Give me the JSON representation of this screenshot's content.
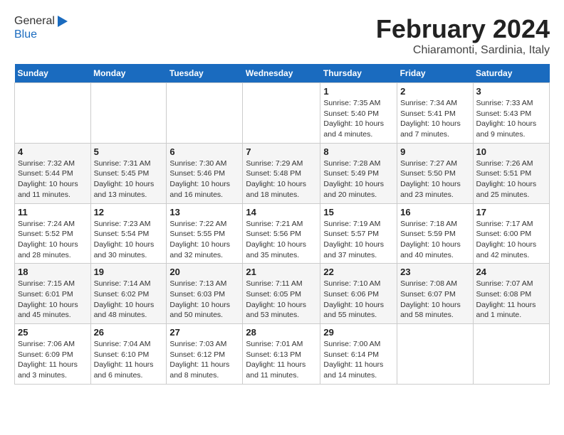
{
  "header": {
    "logo_general": "General",
    "logo_blue": "Blue",
    "title": "February 2024",
    "subtitle": "Chiaramonti, Sardinia, Italy"
  },
  "days_of_week": [
    "Sunday",
    "Monday",
    "Tuesday",
    "Wednesday",
    "Thursday",
    "Friday",
    "Saturday"
  ],
  "weeks": [
    [
      {
        "day": "",
        "info": ""
      },
      {
        "day": "",
        "info": ""
      },
      {
        "day": "",
        "info": ""
      },
      {
        "day": "",
        "info": ""
      },
      {
        "day": "1",
        "info": "Sunrise: 7:35 AM\nSunset: 5:40 PM\nDaylight: 10 hours\nand 4 minutes."
      },
      {
        "day": "2",
        "info": "Sunrise: 7:34 AM\nSunset: 5:41 PM\nDaylight: 10 hours\nand 7 minutes."
      },
      {
        "day": "3",
        "info": "Sunrise: 7:33 AM\nSunset: 5:43 PM\nDaylight: 10 hours\nand 9 minutes."
      }
    ],
    [
      {
        "day": "4",
        "info": "Sunrise: 7:32 AM\nSunset: 5:44 PM\nDaylight: 10 hours\nand 11 minutes."
      },
      {
        "day": "5",
        "info": "Sunrise: 7:31 AM\nSunset: 5:45 PM\nDaylight: 10 hours\nand 13 minutes."
      },
      {
        "day": "6",
        "info": "Sunrise: 7:30 AM\nSunset: 5:46 PM\nDaylight: 10 hours\nand 16 minutes."
      },
      {
        "day": "7",
        "info": "Sunrise: 7:29 AM\nSunset: 5:48 PM\nDaylight: 10 hours\nand 18 minutes."
      },
      {
        "day": "8",
        "info": "Sunrise: 7:28 AM\nSunset: 5:49 PM\nDaylight: 10 hours\nand 20 minutes."
      },
      {
        "day": "9",
        "info": "Sunrise: 7:27 AM\nSunset: 5:50 PM\nDaylight: 10 hours\nand 23 minutes."
      },
      {
        "day": "10",
        "info": "Sunrise: 7:26 AM\nSunset: 5:51 PM\nDaylight: 10 hours\nand 25 minutes."
      }
    ],
    [
      {
        "day": "11",
        "info": "Sunrise: 7:24 AM\nSunset: 5:52 PM\nDaylight: 10 hours\nand 28 minutes."
      },
      {
        "day": "12",
        "info": "Sunrise: 7:23 AM\nSunset: 5:54 PM\nDaylight: 10 hours\nand 30 minutes."
      },
      {
        "day": "13",
        "info": "Sunrise: 7:22 AM\nSunset: 5:55 PM\nDaylight: 10 hours\nand 32 minutes."
      },
      {
        "day": "14",
        "info": "Sunrise: 7:21 AM\nSunset: 5:56 PM\nDaylight: 10 hours\nand 35 minutes."
      },
      {
        "day": "15",
        "info": "Sunrise: 7:19 AM\nSunset: 5:57 PM\nDaylight: 10 hours\nand 37 minutes."
      },
      {
        "day": "16",
        "info": "Sunrise: 7:18 AM\nSunset: 5:59 PM\nDaylight: 10 hours\nand 40 minutes."
      },
      {
        "day": "17",
        "info": "Sunrise: 7:17 AM\nSunset: 6:00 PM\nDaylight: 10 hours\nand 42 minutes."
      }
    ],
    [
      {
        "day": "18",
        "info": "Sunrise: 7:15 AM\nSunset: 6:01 PM\nDaylight: 10 hours\nand 45 minutes."
      },
      {
        "day": "19",
        "info": "Sunrise: 7:14 AM\nSunset: 6:02 PM\nDaylight: 10 hours\nand 48 minutes."
      },
      {
        "day": "20",
        "info": "Sunrise: 7:13 AM\nSunset: 6:03 PM\nDaylight: 10 hours\nand 50 minutes."
      },
      {
        "day": "21",
        "info": "Sunrise: 7:11 AM\nSunset: 6:05 PM\nDaylight: 10 hours\nand 53 minutes."
      },
      {
        "day": "22",
        "info": "Sunrise: 7:10 AM\nSunset: 6:06 PM\nDaylight: 10 hours\nand 55 minutes."
      },
      {
        "day": "23",
        "info": "Sunrise: 7:08 AM\nSunset: 6:07 PM\nDaylight: 10 hours\nand 58 minutes."
      },
      {
        "day": "24",
        "info": "Sunrise: 7:07 AM\nSunset: 6:08 PM\nDaylight: 11 hours\nand 1 minute."
      }
    ],
    [
      {
        "day": "25",
        "info": "Sunrise: 7:06 AM\nSunset: 6:09 PM\nDaylight: 11 hours\nand 3 minutes."
      },
      {
        "day": "26",
        "info": "Sunrise: 7:04 AM\nSunset: 6:10 PM\nDaylight: 11 hours\nand 6 minutes."
      },
      {
        "day": "27",
        "info": "Sunrise: 7:03 AM\nSunset: 6:12 PM\nDaylight: 11 hours\nand 8 minutes."
      },
      {
        "day": "28",
        "info": "Sunrise: 7:01 AM\nSunset: 6:13 PM\nDaylight: 11 hours\nand 11 minutes."
      },
      {
        "day": "29",
        "info": "Sunrise: 7:00 AM\nSunset: 6:14 PM\nDaylight: 11 hours\nand 14 minutes."
      },
      {
        "day": "",
        "info": ""
      },
      {
        "day": "",
        "info": ""
      }
    ]
  ]
}
